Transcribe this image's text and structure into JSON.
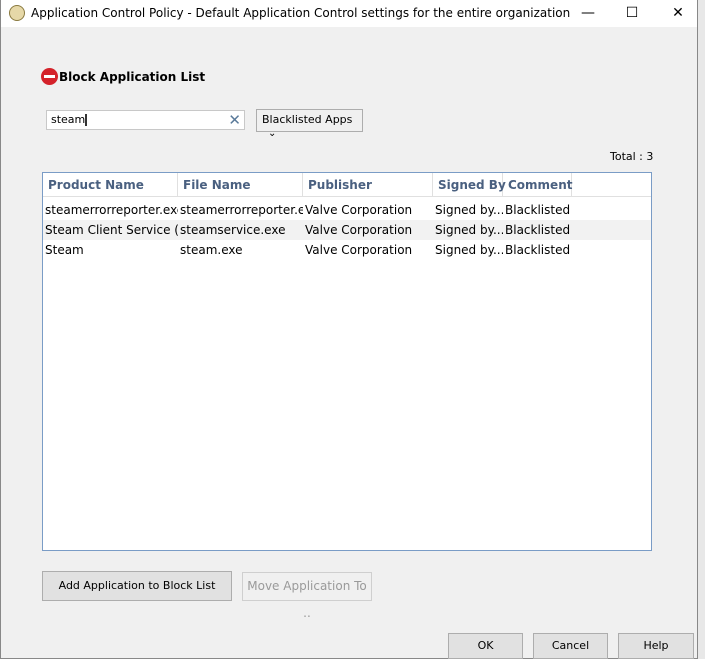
{
  "window": {
    "title": "Application Control Policy - Default Application Control settings for the entire organization",
    "minimize": "—",
    "maximize": "☐",
    "close": "✕"
  },
  "heading": "Block Application List",
  "search": {
    "value": "steam",
    "clear": "✕"
  },
  "filter": {
    "selected": "Blacklisted Apps",
    "chevron": "⌄"
  },
  "total": "Total : 3",
  "table": {
    "columns": [
      "Product Name",
      "File Name",
      "Publisher",
      "Signed By",
      "Comment"
    ],
    "rows": [
      [
        "steamerrorreporter.exe...",
        "steamerrorreporter.e...",
        "Valve Corporation",
        "Signed by...",
        "Blacklisted"
      ],
      [
        "Steam Client Service (b...",
        "steamservice.exe",
        "Valve Corporation",
        "Signed by...",
        "Blacklisted"
      ],
      [
        "Steam",
        "steam.exe",
        "Valve Corporation",
        "Signed by...",
        "Blacklisted"
      ]
    ]
  },
  "buttons": {
    "add": "Add Application to Block List",
    "move": "Move Application To ..",
    "ok": "OK",
    "cancel": "Cancel",
    "help": "Help"
  }
}
